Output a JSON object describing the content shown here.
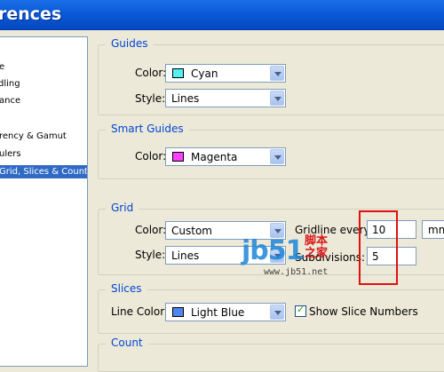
{
  "window": {
    "title": "rences"
  },
  "sidebar": {
    "items": [
      {
        "label": "e",
        "selected": false
      },
      {
        "label": "dling",
        "selected": false
      },
      {
        "label": "ance",
        "selected": false
      },
      {
        "label": "rency & Gamut",
        "selected": false
      },
      {
        "label": "ulers",
        "selected": false
      },
      {
        "label": "Grid, Slices & Count",
        "selected": true
      }
    ]
  },
  "guides": {
    "legend": "Guides",
    "color_label": "Color:",
    "color_value": "Cyan",
    "color_swatch": "#55f0f0",
    "style_label": "Style:",
    "style_value": "Lines"
  },
  "smart_guides": {
    "legend": "Smart Guides",
    "color_label": "Color:",
    "color_value": "Magenta",
    "color_swatch": "#ff40ff"
  },
  "grid": {
    "legend": "Grid",
    "color_label": "Color:",
    "color_value": "Custom",
    "style_label": "Style:",
    "style_value": "Lines",
    "gridline_label": "Gridline every:",
    "gridline_value": "10",
    "gridline_unit": "mm",
    "subdivisions_label": "Subdivisions:",
    "subdivisions_value": "5"
  },
  "slices": {
    "legend": "Slices",
    "line_color_label": "Line Color:",
    "line_color_value": "Light Blue",
    "line_color_swatch": "#4f86f0",
    "show_numbers_label": "Show Slice Numbers",
    "show_numbers_checked": true
  },
  "count": {
    "legend": "Count"
  },
  "watermark": {
    "logo": "jb51",
    "cn_line1": "脚本",
    "cn_line2": "之家",
    "url": "www.jb51.net"
  }
}
